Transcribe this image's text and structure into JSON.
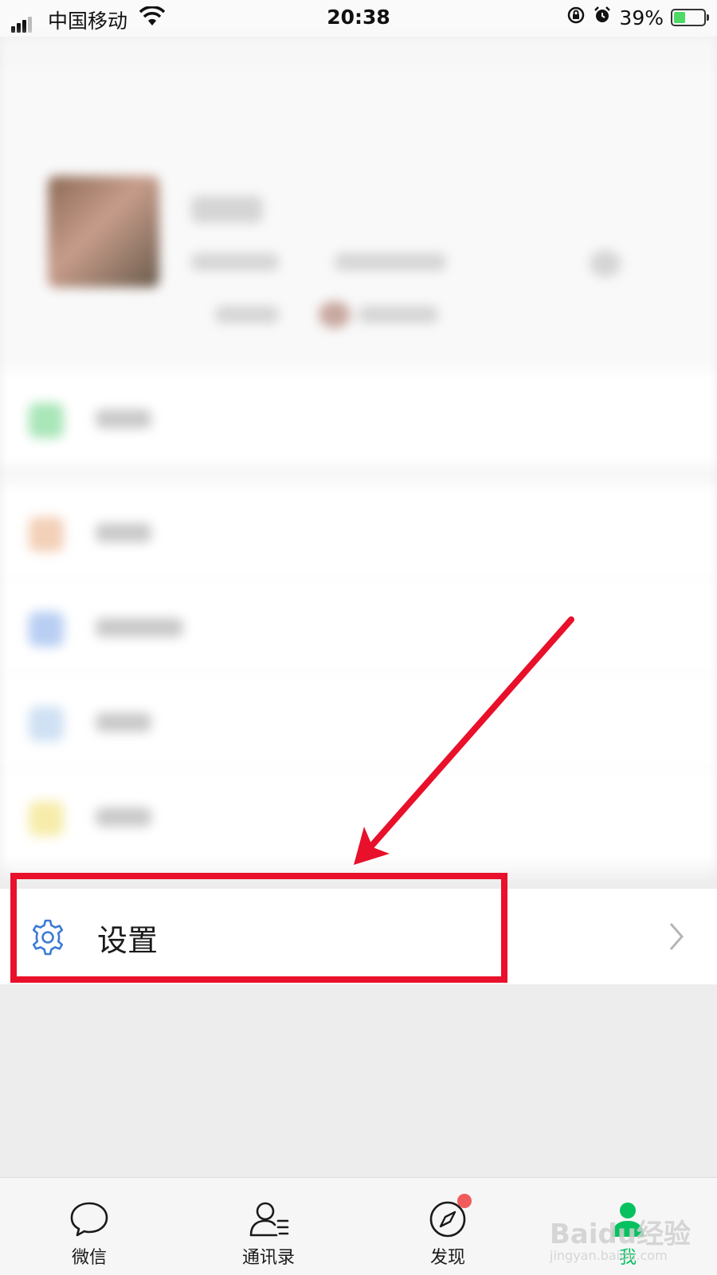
{
  "status_bar": {
    "carrier": "中国移动",
    "time": "20:38",
    "battery": "39%",
    "battery_level": 0.39
  },
  "settings": {
    "label": "设置"
  },
  "tabbar": {
    "tabs": [
      {
        "label": "微信",
        "icon": "chat-bubble-icon"
      },
      {
        "label": "通讯录",
        "icon": "contacts-icon"
      },
      {
        "label": "发现",
        "icon": "compass-icon",
        "badge": true
      },
      {
        "label": "我",
        "icon": "person-icon",
        "active": true
      }
    ]
  },
  "watermark": {
    "text": "Baidu经验",
    "sub": "jingyan.baidu.com"
  },
  "colors": {
    "accent_green": "#07c160",
    "highlight_red": "#e8102a",
    "gear_blue": "#3b7bd6"
  }
}
